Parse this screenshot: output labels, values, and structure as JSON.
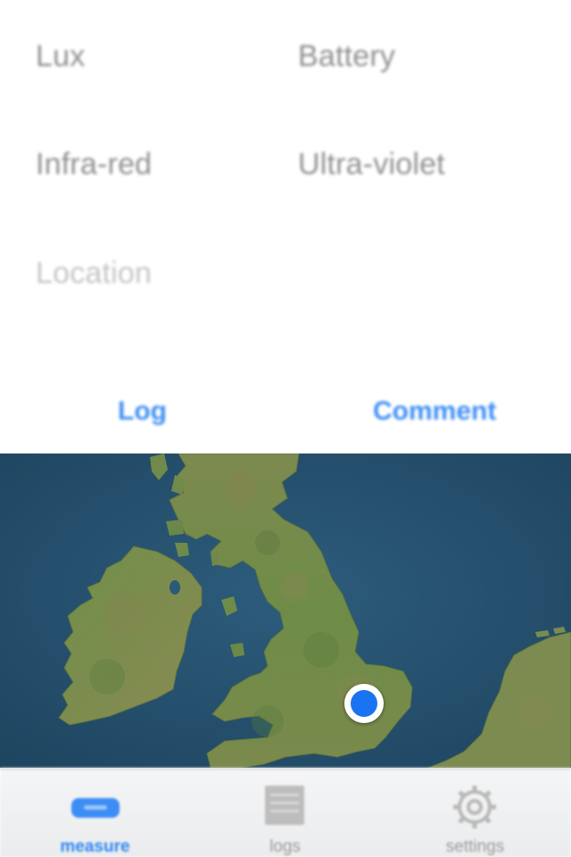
{
  "readings": {
    "lux_label": "Lux",
    "battery_label": "Battery",
    "infrared_label": "Infra-red",
    "ultraviolet_label": "Ultra-violet",
    "location_label": "Location"
  },
  "actions": {
    "log_label": "Log",
    "comment_label": "Comment"
  },
  "map": {
    "style": "satellite",
    "region": "British Isles",
    "location_marker_color": "#1a73f0"
  },
  "tabbar": {
    "tabs": [
      {
        "label": "measure",
        "icon": "measure-icon",
        "selected": true
      },
      {
        "label": "logs",
        "icon": "logs-icon",
        "selected": false
      },
      {
        "label": "settings",
        "icon": "gear-icon",
        "selected": false
      }
    ]
  },
  "colors": {
    "accent": "#3f8ff6",
    "label_gray": "#8f8f8f",
    "sea": "#27506f",
    "land": "#6f8a4a"
  }
}
